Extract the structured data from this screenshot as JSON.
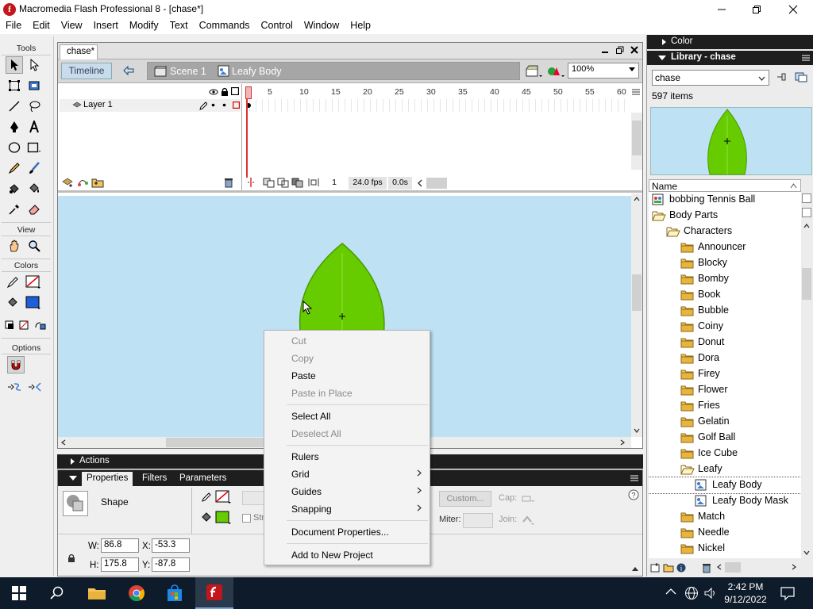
{
  "window": {
    "title": "Macromedia Flash Professional 8 - [chase*]",
    "app_icon_letter": "f"
  },
  "menubar": [
    "File",
    "Edit",
    "View",
    "Insert",
    "Modify",
    "Text",
    "Commands",
    "Control",
    "Window",
    "Help"
  ],
  "tools": {
    "header": "Tools",
    "view_header": "View",
    "colors_header": "Colors",
    "options_header": "Options"
  },
  "document": {
    "tab": "chase*",
    "timeline_button": "Timeline",
    "scene": "Scene 1",
    "symbol": "Leafy Body",
    "zoom": "100%"
  },
  "timeline": {
    "layer_name": "Layer 1",
    "ruler_ticks": [
      "5",
      "10",
      "15",
      "20",
      "25",
      "30",
      "35",
      "40",
      "45",
      "50",
      "55",
      "60"
    ],
    "current_frame": "1",
    "fps": "24.0 fps",
    "elapsed": "0.0s"
  },
  "actions_label": "Actions",
  "properties": {
    "tabs": [
      "Properties",
      "Filters",
      "Parameters"
    ],
    "type": "Shape",
    "w_label": "W:",
    "w": "86.8",
    "x_label": "X:",
    "x": "-53.3",
    "h_label": "H:",
    "h": "175.8",
    "y_label": "Y:",
    "y": "-87.8",
    "stroke_label": "Str",
    "custom_button": "Custom...",
    "cap_label": "Cap:",
    "miter_label": "Miter:",
    "join_label": "Join:"
  },
  "context_menu": {
    "items": [
      {
        "label": "Cut",
        "enabled": false
      },
      {
        "label": "Copy",
        "enabled": false
      },
      {
        "label": "Paste",
        "enabled": true
      },
      {
        "label": "Paste in Place",
        "enabled": false
      },
      {
        "label": "Select All",
        "enabled": true
      },
      {
        "label": "Deselect All",
        "enabled": false
      },
      {
        "label": "Rulers",
        "enabled": true
      },
      {
        "label": "Grid",
        "enabled": true,
        "submenu": true
      },
      {
        "label": "Guides",
        "enabled": true,
        "submenu": true
      },
      {
        "label": "Snapping",
        "enabled": true,
        "submenu": true
      },
      {
        "label": "Document Properties...",
        "enabled": true
      },
      {
        "label": "Add to New Project",
        "enabled": true
      }
    ]
  },
  "color_panel": "Color",
  "library": {
    "title": "Library - chase",
    "selected_library": "chase",
    "item_count": "597 items",
    "column_name": "Name",
    "items": [
      {
        "label": "bobbing Tennis Ball",
        "kind": "movie",
        "level": 0
      },
      {
        "label": "Body Parts",
        "kind": "folder-open",
        "level": 0
      },
      {
        "label": "Characters",
        "kind": "folder-open",
        "level": 1
      },
      {
        "label": "Announcer",
        "kind": "folder",
        "level": 2
      },
      {
        "label": "Blocky",
        "kind": "folder",
        "level": 2
      },
      {
        "label": "Bomby",
        "kind": "folder",
        "level": 2
      },
      {
        "label": "Book",
        "kind": "folder",
        "level": 2
      },
      {
        "label": "Bubble",
        "kind": "folder",
        "level": 2
      },
      {
        "label": "Coiny",
        "kind": "folder",
        "level": 2
      },
      {
        "label": "Donut",
        "kind": "folder",
        "level": 2
      },
      {
        "label": "Dora",
        "kind": "folder",
        "level": 2
      },
      {
        "label": "Firey",
        "kind": "folder",
        "level": 2
      },
      {
        "label": "Flower",
        "kind": "folder",
        "level": 2
      },
      {
        "label": "Fries",
        "kind": "folder",
        "level": 2
      },
      {
        "label": "Gelatin",
        "kind": "folder",
        "level": 2
      },
      {
        "label": "Golf Ball",
        "kind": "folder",
        "level": 2
      },
      {
        "label": "Ice Cube",
        "kind": "folder",
        "level": 2
      },
      {
        "label": "Leafy",
        "kind": "folder-open",
        "level": 2
      },
      {
        "label": "Leafy Body",
        "kind": "graphic",
        "level": 3,
        "selected": true
      },
      {
        "label": "Leafy Body Mask",
        "kind": "graphic",
        "level": 3
      },
      {
        "label": "Match",
        "kind": "folder",
        "level": 2
      },
      {
        "label": "Needle",
        "kind": "folder",
        "level": 2
      },
      {
        "label": "Nickel",
        "kind": "folder",
        "level": 2
      }
    ]
  },
  "taskbar": {
    "time": "2:42 PM",
    "date": "9/12/2022"
  },
  "colors": {
    "stage": "#bee1f4",
    "leaf_fill": "#66cc00",
    "leaf_stroke": "#4a9c00",
    "taskbar": "#0d1b2a",
    "panel_header": "#1e1e1e"
  }
}
